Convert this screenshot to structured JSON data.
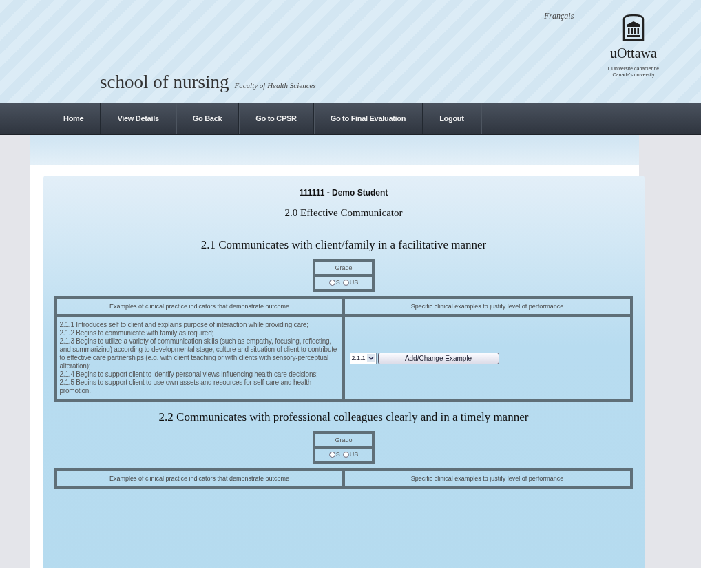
{
  "header": {
    "language_link": "Français",
    "title": "school of nursing",
    "subtitle": "Faculty of Health Sciences",
    "logo_name": "uOttawa",
    "logo_tagline": [
      "L'Université canadienne",
      "Canada's university"
    ]
  },
  "nav": [
    "Home",
    "View Details",
    "Go Back",
    "Go to CPSR",
    "Go to Final Evaluation",
    "Logout"
  ],
  "student": "111111 - Demo Student",
  "domain": "2.0 Effective Communicator",
  "sections": [
    {
      "title": "2.1 Communicates with client/family in a facilitative manner",
      "grade_label": "Grade",
      "options": [
        {
          "label": "S",
          "selected": false
        },
        {
          "label": "US",
          "selected": false
        }
      ],
      "columns": [
        "Examples of clinical practice indicators that demonstrate outcome",
        "Specific clinical examples to justify level of performance"
      ],
      "indicators": [
        "2.1.1 Introduces self to client and explains purpose of interaction while providing care;",
        "2.1.2 Begins to communicate with family as required;",
        "2.1.3 Begins to utilize a variety of communication skills (such as empathy, focusing, reflecting, and summarizing) according to developmental stage, culture and situation of client to contribute to effective care partnerships (e.g. with client teaching or with clients with sensory-perceptual alteration);",
        "2.1.4 Begins to support client to identify personal views influencing health care decisions;",
        "2.1.5 Begins to support client to use own assets and resources for self-care and health promotion."
      ],
      "example_select": "2.1.1",
      "button": "Add/Change Example"
    },
    {
      "title": "2.2 Communicates with professional colleagues clearly and in a timely manner",
      "grade_label": "Grado",
      "options": [
        {
          "label": "S",
          "selected": false
        },
        {
          "label": "US",
          "selected": false
        }
      ],
      "columns": [
        "Examples of clinical practice indicators that demonstrate outcome",
        "Specific clinical examples to justify level of performance"
      ]
    }
  ]
}
